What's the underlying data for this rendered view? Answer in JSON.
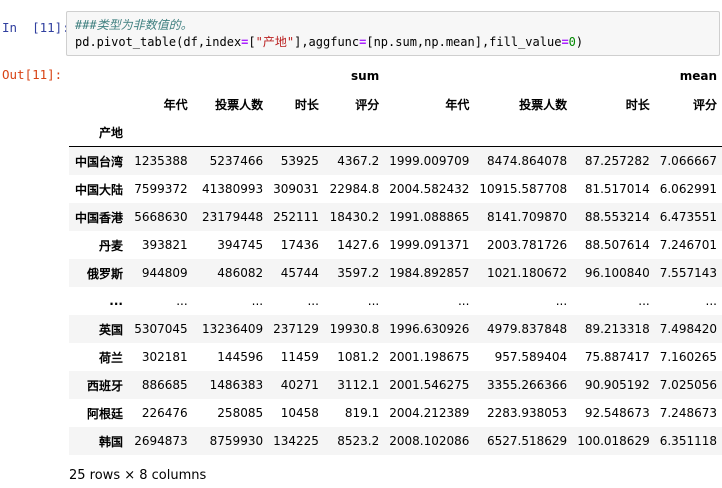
{
  "input_prompt": "In  [11]:",
  "output_prompt": "Out[11]:",
  "code": {
    "comment": "###类型为非数值的。",
    "segments": [
      {
        "t": "pd.pivot_table(df,index",
        "c": ""
      },
      {
        "t": "=",
        "c": "cm-op"
      },
      {
        "t": "[",
        "c": ""
      },
      {
        "t": "\"产地\"",
        "c": "cm-str"
      },
      {
        "t": "],aggfunc",
        "c": ""
      },
      {
        "t": "=",
        "c": "cm-op"
      },
      {
        "t": "[np.sum,np.mean],fill_value",
        "c": ""
      },
      {
        "t": "=",
        "c": "cm-op"
      },
      {
        "t": "0",
        "c": "cm-num"
      },
      {
        "t": ")",
        "c": ""
      }
    ]
  },
  "table": {
    "top_headers": [
      "sum",
      "mean"
    ],
    "columns": [
      "年代",
      "投票人数",
      "时长",
      "评分",
      "年代",
      "投票人数",
      "时长",
      "评分"
    ],
    "index_name": "产地",
    "rows": [
      {
        "index": "中国台湾",
        "cells": [
          "1235388",
          "5237466",
          "53925",
          "4367.2",
          "1999.009709",
          "8474.864078",
          "87.257282",
          "7.066667"
        ]
      },
      {
        "index": "中国大陆",
        "cells": [
          "7599372",
          "41380993",
          "309031",
          "22984.8",
          "2004.582432",
          "10915.587708",
          "81.517014",
          "6.062991"
        ]
      },
      {
        "index": "中国香港",
        "cells": [
          "5668630",
          "23179448",
          "252111",
          "18430.2",
          "1991.088865",
          "8141.709870",
          "88.553214",
          "6.473551"
        ]
      },
      {
        "index": "丹麦",
        "cells": [
          "393821",
          "394745",
          "17436",
          "1427.6",
          "1999.091371",
          "2003.781726",
          "88.507614",
          "7.246701"
        ]
      },
      {
        "index": "俄罗斯",
        "cells": [
          "944809",
          "486082",
          "45744",
          "3597.2",
          "1984.892857",
          "1021.180672",
          "96.100840",
          "7.557143"
        ]
      },
      {
        "index": "...",
        "cells": [
          "...",
          "...",
          "...",
          "...",
          "...",
          "...",
          "...",
          "..."
        ]
      },
      {
        "index": "英国",
        "cells": [
          "5307045",
          "13236409",
          "237129",
          "19930.8",
          "1996.630926",
          "4979.837848",
          "89.213318",
          "7.498420"
        ]
      },
      {
        "index": "荷兰",
        "cells": [
          "302181",
          "144596",
          "11459",
          "1081.2",
          "2001.198675",
          "957.589404",
          "75.887417",
          "7.160265"
        ]
      },
      {
        "index": "西班牙",
        "cells": [
          "886685",
          "1486383",
          "40271",
          "3112.1",
          "2001.546275",
          "3355.266366",
          "90.905192",
          "7.025056"
        ]
      },
      {
        "index": "阿根廷",
        "cells": [
          "226476",
          "258085",
          "10458",
          "819.1",
          "2004.212389",
          "2283.938053",
          "92.548673",
          "7.248673"
        ]
      },
      {
        "index": "韩国",
        "cells": [
          "2694873",
          "8759930",
          "134225",
          "8523.2",
          "2008.102086",
          "6527.518629",
          "100.018629",
          "6.351118"
        ]
      }
    ],
    "shape_text": "25 rows × 8 columns"
  }
}
